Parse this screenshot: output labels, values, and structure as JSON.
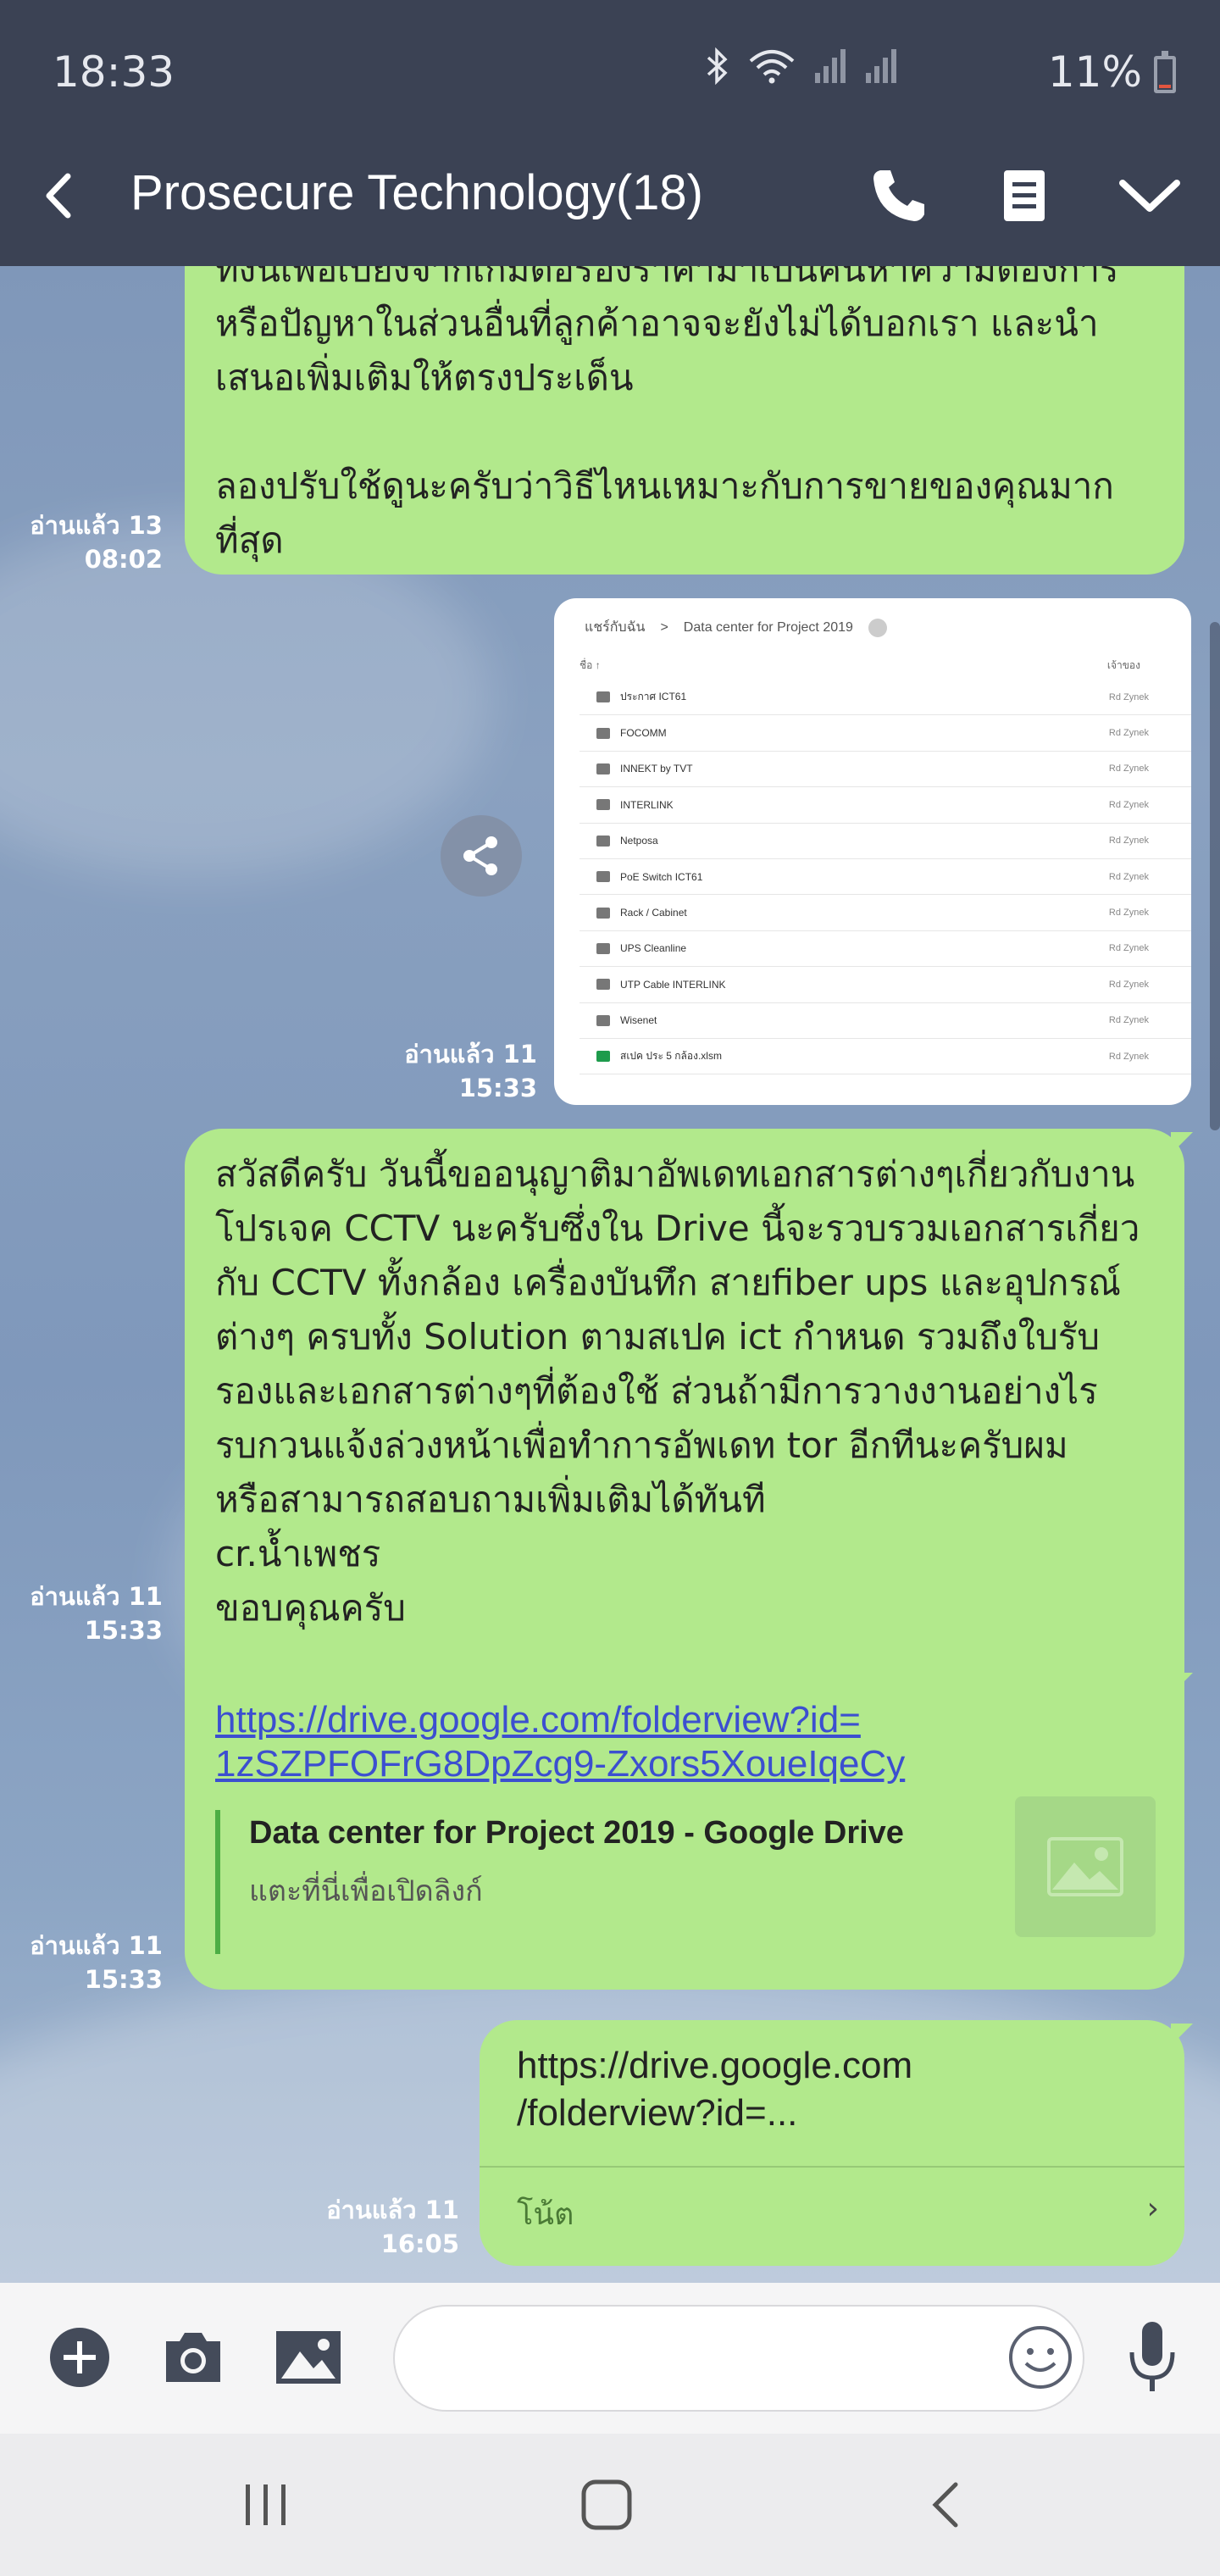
{
  "status_bar": {
    "time": "18:33",
    "battery_percent": "11%",
    "battery_level": 0.11
  },
  "header": {
    "title": "Prosecure Technology(18)"
  },
  "messages": [
    {
      "text": "ทั้งนี้เพื่อเบี่ยงจากเกมต่อรองราคามาเป็นค้นหาความต้องการ\nหรือปัญหาในส่วนอื่นที่ลูกค้าอาจจะยังไม่ได้บอกเรา และนำ\nเสนอเพิ่มเติมให้ตรงประเด็น\n\nลองปรับใช้ดูนะครับว่าวิธีไหนเหมาะกับการขายของคุณมาก\nที่สุด",
      "read": "อ่านแล้ว 13",
      "time": "08:02"
    },
    {
      "image": {
        "breadcrumb_root": "แชร์กับฉัน",
        "breadcrumb_sep": ">",
        "folder": "Data center for Project 2019",
        "col_name": "ชื่อ",
        "col_owner": "เจ้าของ",
        "rows": [
          {
            "name": "ประกาศ ICT61",
            "owner": "Rd Zynek"
          },
          {
            "name": "FOCOMM",
            "owner": "Rd Zynek"
          },
          {
            "name": "INNEKT by TVT",
            "owner": "Rd Zynek"
          },
          {
            "name": "INTERLINK",
            "owner": "Rd Zynek"
          },
          {
            "name": "Netposa",
            "owner": "Rd Zynek"
          },
          {
            "name": "PoE Switch ICT61",
            "owner": "Rd Zynek"
          },
          {
            "name": "Rack / Cabinet",
            "owner": "Rd Zynek"
          },
          {
            "name": "UPS Cleanline",
            "owner": "Rd Zynek"
          },
          {
            "name": "UTP Cable INTERLINK",
            "owner": "Rd Zynek"
          },
          {
            "name": "Wisenet",
            "owner": "Rd Zynek"
          },
          {
            "name": "สเปค ประ 5 กล้อง.xlsm",
            "owner": "Rd Zynek"
          }
        ]
      },
      "read": "อ่านแล้ว 11",
      "time": "15:33"
    },
    {
      "text": "สวัสดีครับ วันนี้ขออนุญาติมาอัพเดทเอกสารต่างๆเกี่ยวกับงาน\nโปรเจค CCTV นะครับซึ่งใน Drive นี้จะรวบรวมเอกสารเกี่ยว\nกับ CCTV ทั้งกล้อง เครื่องบันทึก สายfiber ups และอุปกรณ์\nต่างๆ ครบทั้ง Solution ตามสเปค ict กำหนด รวมถึงใบรับ\nรองและเอกสารต่างๆที่ต้องใช้ ส่วนถ้ามีการวางงานอย่างไร\nรบกวนแจ้งล่วงหน้าเพื่อทำการอัพเดท tor อีกทีนะครับผม\nหรือสามารถสอบถามเพิ่มเติมได้ทันที\ncr.น้ำเพชร\nขอบคุณครับ",
      "read": "อ่านแล้ว 11",
      "time": "15:33"
    },
    {
      "link": "https://drive.google.com/folderview?id=\n1zSZPFOFrG8DpZcg9-Zxors5XoueIqeCy",
      "preview_title": "Data center for Project 2019 - Google Drive",
      "preview_sub": "แตะที่นี่เพื่อเปิดลิงก์",
      "read": "อ่านแล้ว 11",
      "time": "15:33"
    },
    {
      "text": "https://drive.google.com\n/folderview?id=...",
      "note_label": "โน้ต",
      "read": "อ่านแล้ว 11",
      "time": "16:05"
    }
  ],
  "input": {
    "placeholder": ""
  },
  "icons": {
    "back": "chevron-left-icon",
    "call": "phone-icon",
    "notes": "note-icon",
    "menu": "chevron-down-icon",
    "add": "plus-icon",
    "camera": "camera-icon",
    "gallery": "image-icon",
    "emoji": "emoji-icon",
    "mic": "mic-icon",
    "share": "share-icon"
  },
  "colors": {
    "bubble": "#b2e98c",
    "header": "#3b4254",
    "link": "#3c4fd0"
  }
}
